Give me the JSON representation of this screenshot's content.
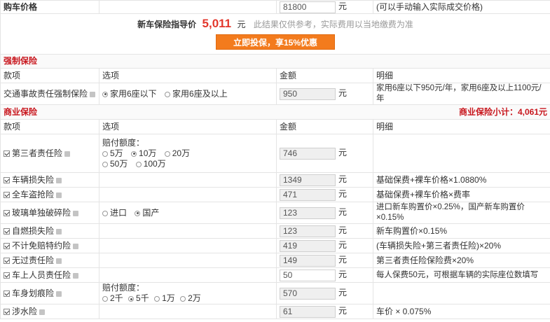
{
  "car_price": {
    "label": "购车价格",
    "value": "81800",
    "unit": "元",
    "hint": "(可以手动输入实际成交价格)"
  },
  "summary": {
    "guide_label": "新车保险指导价",
    "price": "5,011",
    "unit": "元",
    "note": "此结果仅供参考，实际费用以当地缴费为准",
    "cta": "立即投保，享15%优惠"
  },
  "compulsory": {
    "title": "强制保险",
    "headers": {
      "item": "款项",
      "option": "选项",
      "amount": "金额",
      "detail": "明细"
    },
    "row": {
      "name": "交通事故责任强制保险",
      "opt1": "家用6座以下",
      "opt2": "家用6座及以上",
      "amount": "950",
      "unit": "元",
      "detail": "家用6座以下950元/年，家用6座及以上1100元/年"
    }
  },
  "commercial": {
    "title": "商业保险",
    "subtotal": "商业保险小计：4,061元",
    "headers": {
      "item": "款项",
      "option": "选项",
      "amount": "金额",
      "detail": "明细"
    },
    "third_party": {
      "name": "第三者责任险",
      "quota_label": "赔付额度：",
      "opts": [
        "5万",
        "10万",
        "20万",
        "50万",
        "100万"
      ],
      "amount": "746",
      "unit": "元"
    },
    "vehicle_damage": {
      "name": "车辆损失险",
      "amount": "1349",
      "unit": "元",
      "detail": "基础保费+裸车价格×1.0880%"
    },
    "theft": {
      "name": "全车盗抢险",
      "amount": "471",
      "unit": "元",
      "detail": "基础保费+裸车价格×费率"
    },
    "glass": {
      "name": "玻璃单独破碎险",
      "opt1": "进口",
      "opt2": "国产",
      "amount": "123",
      "unit": "元",
      "detail": "进口新车购置价×0.25%，国产新车购置价×0.15%"
    },
    "fire": {
      "name": "自燃损失险",
      "amount": "123",
      "unit": "元",
      "detail": "新车购置价×0.15%"
    },
    "deductible": {
      "name": "不计免赔特约险",
      "amount": "419",
      "unit": "元",
      "detail": "(车辆损失险+第三者责任险)×20%"
    },
    "no_fault": {
      "name": "无过责任险",
      "amount": "149",
      "unit": "元",
      "detail": "第三者责任险保险费×20%"
    },
    "passenger": {
      "name": "车上人员责任险",
      "amount": "50",
      "unit": "元",
      "detail": "每人保费50元，可根据车辆的实际座位数填写"
    },
    "scratch": {
      "name": "车身划痕险",
      "quota_label": "赔付额度：",
      "opts": [
        "2千",
        "5千",
        "1万",
        "2万"
      ],
      "amount": "570",
      "unit": "元"
    },
    "wading": {
      "name": "涉水险",
      "amount": "61",
      "unit": "元",
      "detail": "车价 × 0.075%"
    }
  }
}
